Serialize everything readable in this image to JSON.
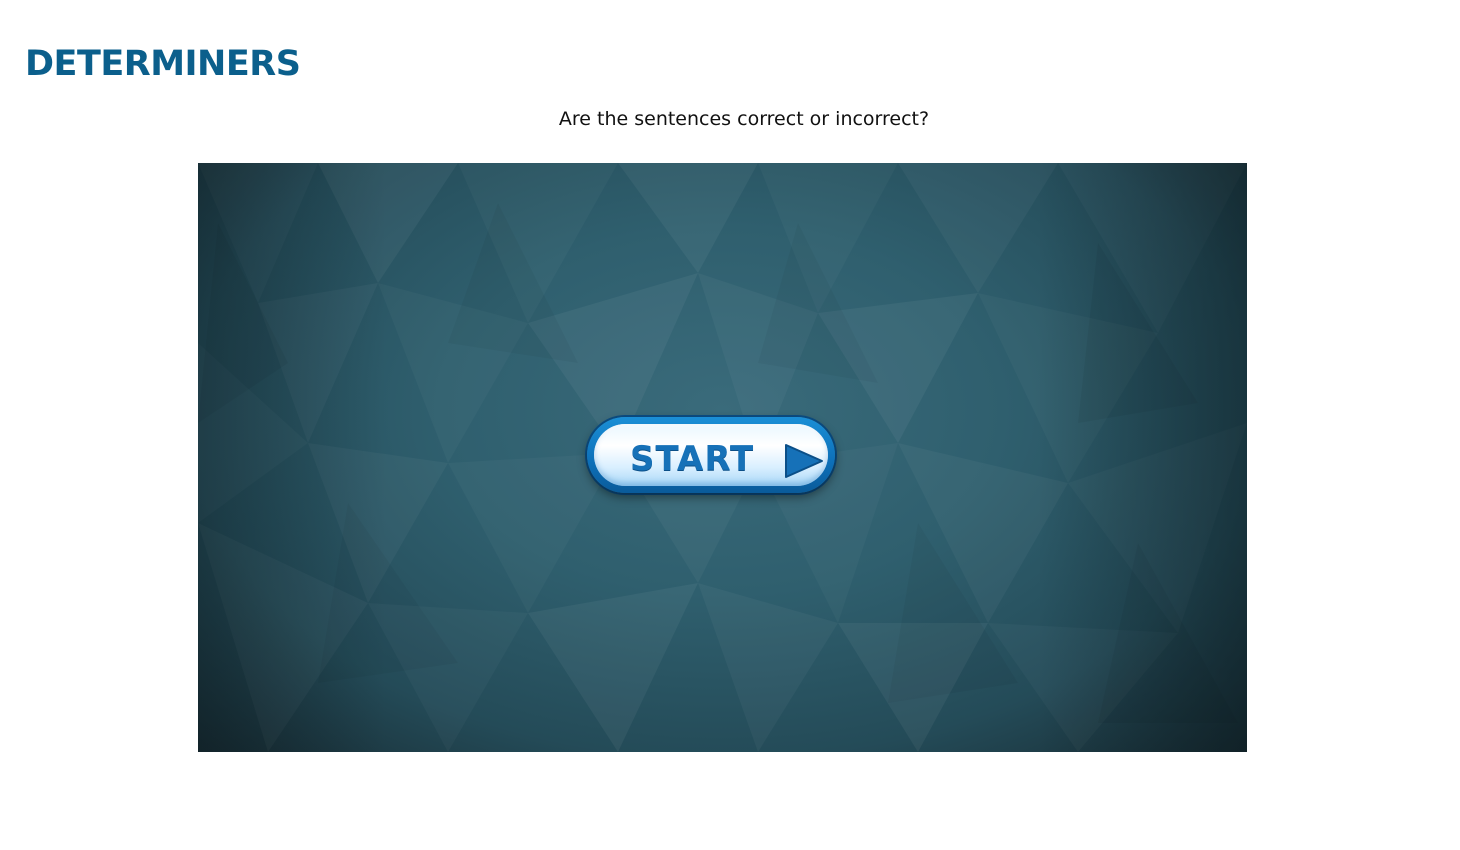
{
  "header": {
    "title": "DETERMINERS",
    "instruction": "Are the sentences correct or incorrect?"
  },
  "game": {
    "start_label": "START",
    "start_icon": "play-arrow-icon"
  },
  "colors": {
    "title": "#0b5f8c",
    "game_background": "#2f5f6e",
    "button_text": "#1671b8",
    "button_border": "#0d6fb8"
  }
}
